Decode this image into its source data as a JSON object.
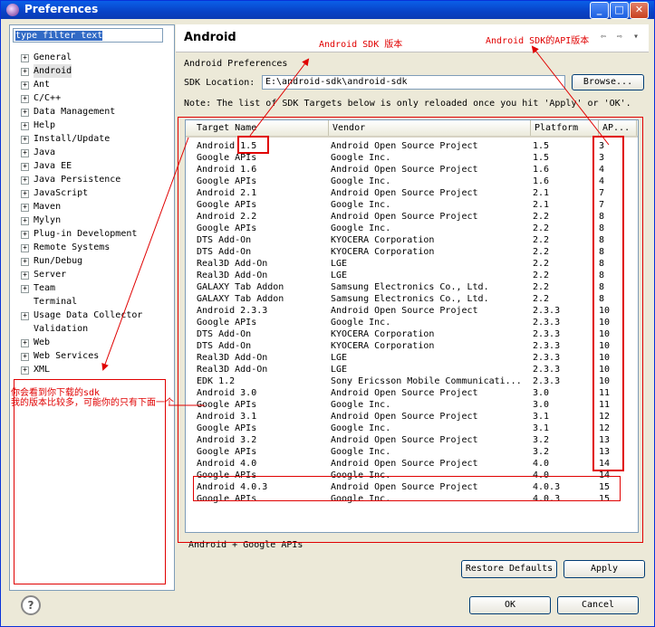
{
  "window": {
    "title": "Preferences",
    "controls": {
      "minimize": "_",
      "maximize": "□",
      "close": "✕"
    }
  },
  "filter": {
    "value": "type filter text"
  },
  "tree": {
    "items": [
      {
        "label": "General",
        "expandable": true
      },
      {
        "label": "Android",
        "expandable": true,
        "selected": true
      },
      {
        "label": "Ant",
        "expandable": true
      },
      {
        "label": "C/C++",
        "expandable": true
      },
      {
        "label": "Data Management",
        "expandable": true
      },
      {
        "label": "Help",
        "expandable": true
      },
      {
        "label": "Install/Update",
        "expandable": true
      },
      {
        "label": "Java",
        "expandable": true
      },
      {
        "label": "Java EE",
        "expandable": true
      },
      {
        "label": "Java Persistence",
        "expandable": true
      },
      {
        "label": "JavaScript",
        "expandable": true
      },
      {
        "label": "Maven",
        "expandable": true
      },
      {
        "label": "Mylyn",
        "expandable": true
      },
      {
        "label": "Plug-in Development",
        "expandable": true
      },
      {
        "label": "Remote Systems",
        "expandable": true
      },
      {
        "label": "Run/Debug",
        "expandable": true
      },
      {
        "label": "Server",
        "expandable": true
      },
      {
        "label": "Team",
        "expandable": true
      },
      {
        "label": "Terminal",
        "expandable": false
      },
      {
        "label": "Usage Data Collector",
        "expandable": true
      },
      {
        "label": "Validation",
        "expandable": false
      },
      {
        "label": "Web",
        "expandable": true
      },
      {
        "label": "Web Services",
        "expandable": true
      },
      {
        "label": "XML",
        "expandable": true
      }
    ]
  },
  "page": {
    "title": "Android",
    "nav_arrows": "⇦ ⇨ ▾",
    "prefs_label": "Android Preferences",
    "sdk_location_label": "SDK Location:",
    "sdk_location_value": "E:\\android-sdk\\android-sdk",
    "browse_label": "Browse...",
    "note": "Note: The list of SDK Targets below is only reloaded once you hit 'Apply' or 'OK'.",
    "table": {
      "headers": [
        "Target Name",
        "Vendor",
        "Platform",
        "AP..."
      ],
      "rows": [
        [
          "Android 1.5",
          "Android Open Source Project",
          "1.5",
          "3"
        ],
        [
          "Google APIs",
          "Google Inc.",
          "1.5",
          "3"
        ],
        [
          "Android 1.6",
          "Android Open Source Project",
          "1.6",
          "4"
        ],
        [
          "Google APIs",
          "Google Inc.",
          "1.6",
          "4"
        ],
        [
          "Android 2.1",
          "Android Open Source Project",
          "2.1",
          "7"
        ],
        [
          "Google APIs",
          "Google Inc.",
          "2.1",
          "7"
        ],
        [
          "Android 2.2",
          "Android Open Source Project",
          "2.2",
          "8"
        ],
        [
          "Google APIs",
          "Google Inc.",
          "2.2",
          "8"
        ],
        [
          "DTS Add-On",
          "KYOCERA Corporation",
          "2.2",
          "8"
        ],
        [
          "DTS Add-On",
          "KYOCERA Corporation",
          "2.2",
          "8"
        ],
        [
          "Real3D Add-On",
          "LGE",
          "2.2",
          "8"
        ],
        [
          "Real3D Add-On",
          "LGE",
          "2.2",
          "8"
        ],
        [
          "GALAXY Tab Addon",
          "Samsung Electronics Co., Ltd.",
          "2.2",
          "8"
        ],
        [
          "GALAXY Tab Addon",
          "Samsung Electronics Co., Ltd.",
          "2.2",
          "8"
        ],
        [
          "Android 2.3.3",
          "Android Open Source Project",
          "2.3.3",
          "10"
        ],
        [
          "Google APIs",
          "Google Inc.",
          "2.3.3",
          "10"
        ],
        [
          "DTS Add-On",
          "KYOCERA Corporation",
          "2.3.3",
          "10"
        ],
        [
          "DTS Add-On",
          "KYOCERA Corporation",
          "2.3.3",
          "10"
        ],
        [
          "Real3D Add-On",
          "LGE",
          "2.3.3",
          "10"
        ],
        [
          "Real3D Add-On",
          "LGE",
          "2.3.3",
          "10"
        ],
        [
          "EDK 1.2",
          "Sony Ericsson Mobile Communicati...",
          "2.3.3",
          "10"
        ],
        [
          "Android 3.0",
          "Android Open Source Project",
          "3.0",
          "11"
        ],
        [
          "Google APIs",
          "Google Inc.",
          "3.0",
          "11"
        ],
        [
          "Android 3.1",
          "Android Open Source Project",
          "3.1",
          "12"
        ],
        [
          "Google APIs",
          "Google Inc.",
          "3.1",
          "12"
        ],
        [
          "Android 3.2",
          "Android Open Source Project",
          "3.2",
          "13"
        ],
        [
          "Google APIs",
          "Google Inc.",
          "3.2",
          "13"
        ],
        [
          "Android 4.0",
          "Android Open Source Project",
          "4.0",
          "14"
        ],
        [
          "Google APIs",
          "Google Inc.",
          "4.0",
          "14"
        ],
        [
          "Android 4.0.3",
          "Android Open Source Project",
          "4.0.3",
          "15"
        ],
        [
          "Google APIs",
          "Google Inc.",
          "4.0.3",
          "15"
        ]
      ]
    },
    "status_text": "Android + Google APIs",
    "restore_defaults_label": "Restore Defaults",
    "apply_label": "Apply"
  },
  "footer": {
    "help_glyph": "?",
    "ok_label": "OK",
    "cancel_label": "Cancel"
  },
  "annotations": {
    "sdk_version": "Android SDK 版本",
    "api_version": "Android SDK的API版本",
    "downloaded_line1": "你会看到你下载的sdk",
    "downloaded_line2": "我的版本比较多，可能你的只有下面一个",
    "color": "#e00000"
  }
}
